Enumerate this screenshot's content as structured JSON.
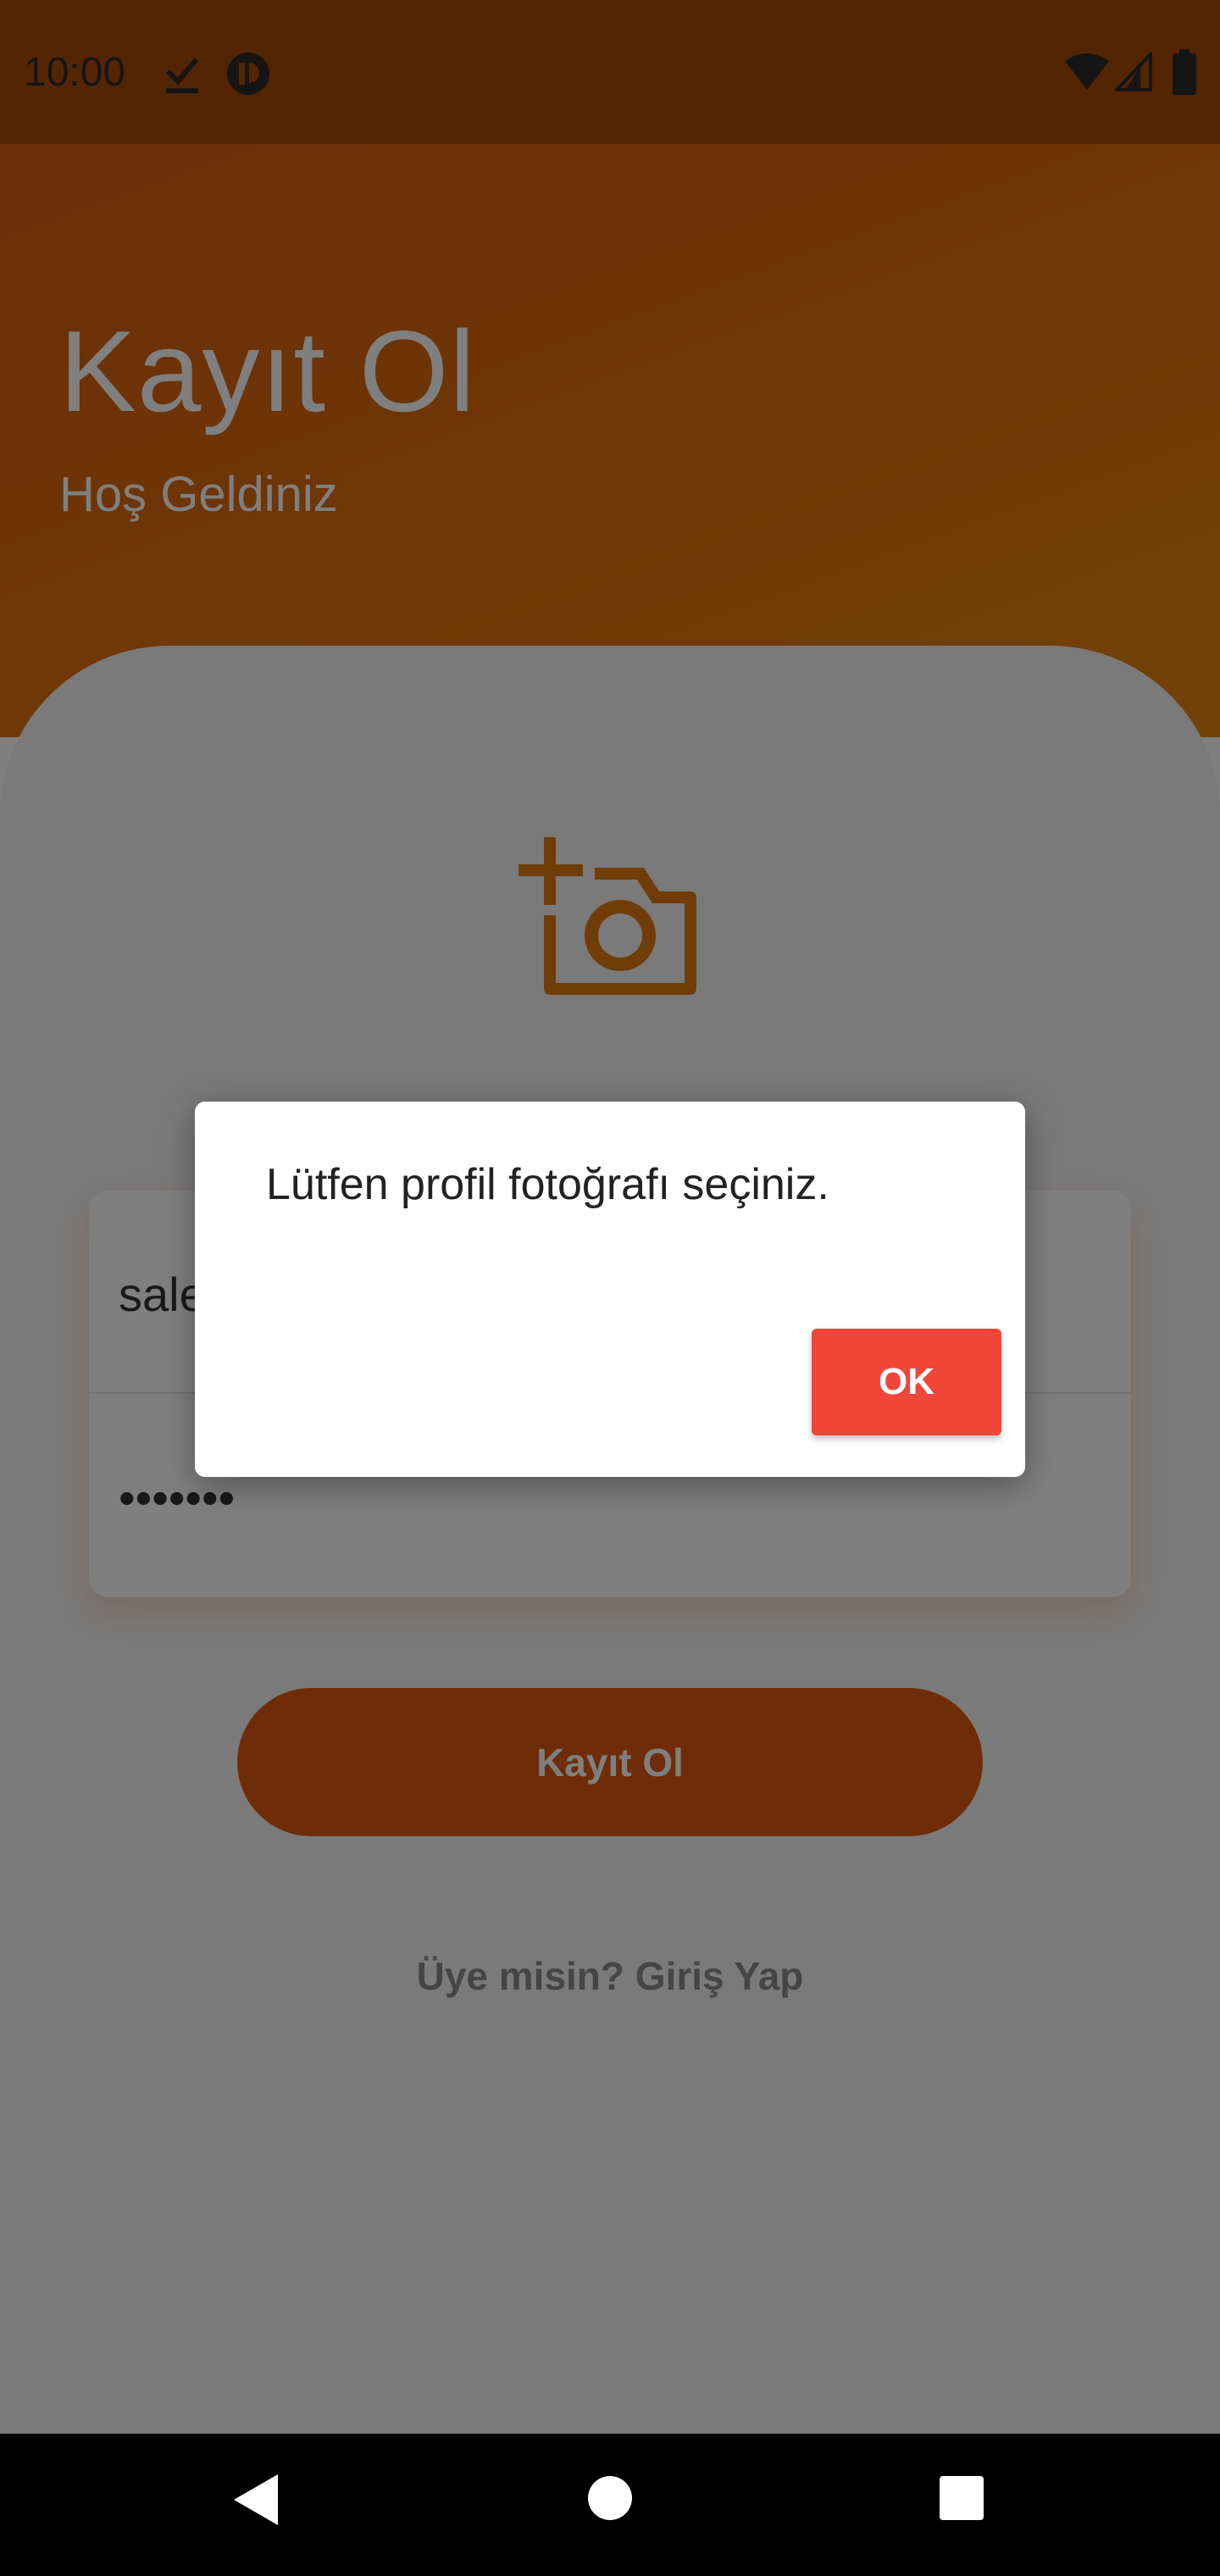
{
  "status_bar": {
    "time": "10:00",
    "icons_left": [
      "checkmark-download-icon",
      "app-notification-icon"
    ],
    "icons_right": [
      "wifi-icon",
      "signal-icon",
      "battery-icon"
    ]
  },
  "header": {
    "title": "Kayıt Ol",
    "subtitle": "Hoş Geldiniz"
  },
  "form": {
    "photo_icon": "add-photo-icon",
    "email_value": "sale",
    "password_value": "•••••••"
  },
  "actions": {
    "register_label": "Kayıt Ol",
    "login_link": "Üye misin? Giriş Yap"
  },
  "dialog": {
    "message": "Lütfen profil fotoğrafı seçiniz.",
    "ok_label": "OK"
  },
  "nav": {
    "icons": [
      "back-icon",
      "home-icon",
      "recents-icon"
    ]
  },
  "colors": {
    "primary": "#dc5a0c",
    "dialog_button": "#f2463a"
  }
}
